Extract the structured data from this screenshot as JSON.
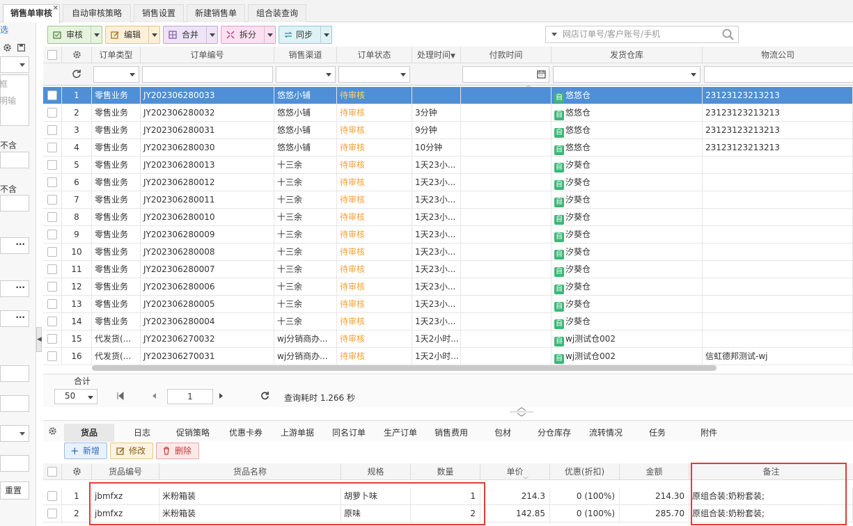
{
  "tabs": [
    {
      "label": "销售单审核"
    },
    {
      "label": "自动审核策略"
    },
    {
      "label": "销售设置"
    },
    {
      "label": "新建销售单"
    },
    {
      "label": "组合装查询"
    }
  ],
  "tab_close": "×",
  "left_panel": {
    "filter_link": "选",
    "item1": "框",
    "item2": "明输",
    "label1": "不含",
    "label2": "不含",
    "dots": "···",
    "reset": "重置"
  },
  "toolbar": {
    "audit": "审核",
    "edit": "编辑",
    "merge": "合并",
    "split": "拆分",
    "sync": "同步",
    "search_placeholder": "网店订单号/客户账号/手机"
  },
  "columns": [
    "订单类型",
    "订单编号",
    "销售渠道",
    "订单状态",
    "处理时间",
    "付款时间",
    "发货仓库",
    "物流公司"
  ],
  "rows": [
    {
      "no": "1",
      "type": "零售业务",
      "order": "JY202306280033",
      "channel": "悠悠小铺",
      "status": "待审核",
      "time": "",
      "pay": "",
      "tag": "自",
      "wh": "悠悠仓",
      "logistics": "23123123213213"
    },
    {
      "no": "2",
      "type": "零售业务",
      "order": "JY202306280032",
      "channel": "悠悠小铺",
      "status": "待审核",
      "time": "3分钟",
      "pay": "",
      "tag": "自",
      "wh": "悠悠仓",
      "logistics": "23123123213213"
    },
    {
      "no": "3",
      "type": "零售业务",
      "order": "JY202306280031",
      "channel": "悠悠小铺",
      "status": "待审核",
      "time": "9分钟",
      "pay": "",
      "tag": "自",
      "wh": "悠悠仓",
      "logistics": "23123123213213"
    },
    {
      "no": "4",
      "type": "零售业务",
      "order": "JY202306280030",
      "channel": "悠悠小铺",
      "status": "待审核",
      "time": "10分钟",
      "pay": "",
      "tag": "自",
      "wh": "悠悠仓",
      "logistics": "23123123213213"
    },
    {
      "no": "5",
      "type": "零售业务",
      "order": "JY202306280013",
      "channel": "十三余",
      "status": "待审核",
      "time": "1天23小...",
      "pay": "",
      "tag": "自",
      "wh": "汐葵仓",
      "logistics": ""
    },
    {
      "no": "6",
      "type": "零售业务",
      "order": "JY202306280012",
      "channel": "十三余",
      "status": "待审核",
      "time": "1天23小...",
      "pay": "",
      "tag": "自",
      "wh": "汐葵仓",
      "logistics": ""
    },
    {
      "no": "7",
      "type": "零售业务",
      "order": "JY202306280011",
      "channel": "十三余",
      "status": "待审核",
      "time": "1天23小...",
      "pay": "",
      "tag": "自",
      "wh": "汐葵仓",
      "logistics": ""
    },
    {
      "no": "8",
      "type": "零售业务",
      "order": "JY202306280010",
      "channel": "十三余",
      "status": "待审核",
      "time": "1天23小...",
      "pay": "",
      "tag": "自",
      "wh": "汐葵仓",
      "logistics": ""
    },
    {
      "no": "9",
      "type": "零售业务",
      "order": "JY202306280009",
      "channel": "十三余",
      "status": "待审核",
      "time": "1天23小...",
      "pay": "",
      "tag": "自",
      "wh": "汐葵仓",
      "logistics": ""
    },
    {
      "no": "10",
      "type": "零售业务",
      "order": "JY202306280008",
      "channel": "十三余",
      "status": "待审核",
      "time": "1天23小...",
      "pay": "",
      "tag": "自",
      "wh": "汐葵仓",
      "logistics": ""
    },
    {
      "no": "11",
      "type": "零售业务",
      "order": "JY202306280007",
      "channel": "十三余",
      "status": "待审核",
      "time": "1天23小...",
      "pay": "",
      "tag": "自",
      "wh": "汐葵仓",
      "logistics": ""
    },
    {
      "no": "12",
      "type": "零售业务",
      "order": "JY202306280006",
      "channel": "十三余",
      "status": "待审核",
      "time": "1天23小...",
      "pay": "",
      "tag": "自",
      "wh": "汐葵仓",
      "logistics": ""
    },
    {
      "no": "13",
      "type": "零售业务",
      "order": "JY202306280005",
      "channel": "十三余",
      "status": "待审核",
      "time": "1天23小...",
      "pay": "",
      "tag": "自",
      "wh": "汐葵仓",
      "logistics": ""
    },
    {
      "no": "14",
      "type": "零售业务",
      "order": "JY202306280004",
      "channel": "十三余",
      "status": "待审核",
      "time": "1天23小...",
      "pay": "",
      "tag": "自",
      "wh": "汐葵仓",
      "logistics": ""
    },
    {
      "no": "15",
      "type": "代发货(...",
      "order": "JY202306270032",
      "channel": "wj分销商办...",
      "status": "待审核",
      "time": "1天2小时...",
      "pay": "",
      "tag": "自",
      "wh": "wj测试仓002",
      "logistics": ""
    },
    {
      "no": "16",
      "type": "代发货(...",
      "order": "JY202306270031",
      "channel": "wj分销商办...",
      "status": "待审核",
      "time": "1天2小时...",
      "pay": "",
      "tag": "自",
      "wh": "wj测试仓002",
      "logistics": "信虹德邦测试-wj"
    }
  ],
  "total_label": "合计",
  "pager": {
    "size": "50",
    "page": "1",
    "query_time": "查询耗时 1.266 秒"
  },
  "bottom_tabs": [
    "货品",
    "日志",
    "促销策略",
    "优惠卡券",
    "上游单据",
    "同名订单",
    "生产订单",
    "销售费用",
    "包材",
    "分仓库存",
    "流转情况",
    "任务",
    "附件"
  ],
  "bottom_buttons": {
    "add": "新增",
    "modify": "修改",
    "delete": "删除"
  },
  "item_columns": [
    "货品编号",
    "货品名称",
    "规格",
    "数量",
    "单价",
    "优惠(折扣)",
    "金额",
    "备注"
  ],
  "items": [
    {
      "no": "1",
      "code": "jbmfxz",
      "name": "米粉箱装",
      "spec": "胡萝卜味",
      "qty": "1",
      "price": "214.3",
      "discount": "0 (100%)",
      "amount": "214.30",
      "remark": "原组合装:奶粉套装;"
    },
    {
      "no": "2",
      "code": "jbmfxz",
      "name": "米粉箱装",
      "spec": "原味",
      "qty": "2",
      "price": "142.85",
      "discount": "0 (100%)",
      "amount": "285.70",
      "remark": "原组合装:奶粉套装;"
    }
  ],
  "colors": {
    "selected_row": "#4f8fd6",
    "pending": "#f0a23a",
    "warehouse_tag": "#3cb878",
    "highlight_box": "#e53935"
  }
}
